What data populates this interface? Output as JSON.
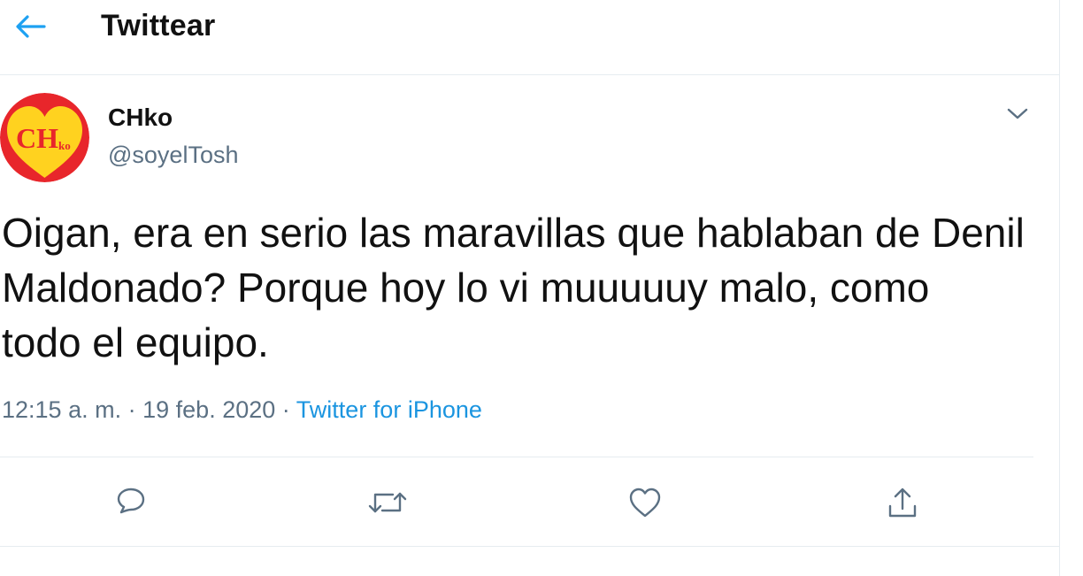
{
  "header": {
    "title": "Twittear",
    "back_icon": "arrow-left-icon",
    "accent_color": "#1da1f2"
  },
  "tweet": {
    "author": {
      "name": "CHko",
      "handle": "@soyelTosh",
      "avatar_text_main": "CH",
      "avatar_text_sub": "ko"
    },
    "text": "Oigan, era en serio las maravillas que hablaban de Denil\nMaldonado? Porque hoy lo vi muuuuuy malo, como\ntodo el equipo.",
    "time": "12:15 a. m.",
    "separator": "·",
    "date": "19 feb. 2020",
    "source": "Twitter for iPhone",
    "source_color": "#1b95e0"
  },
  "actions": [
    {
      "name": "reply",
      "icon": "comment-icon"
    },
    {
      "name": "retweet",
      "icon": "retweet-icon"
    },
    {
      "name": "like",
      "icon": "heart-icon"
    },
    {
      "name": "share",
      "icon": "share-icon"
    }
  ]
}
